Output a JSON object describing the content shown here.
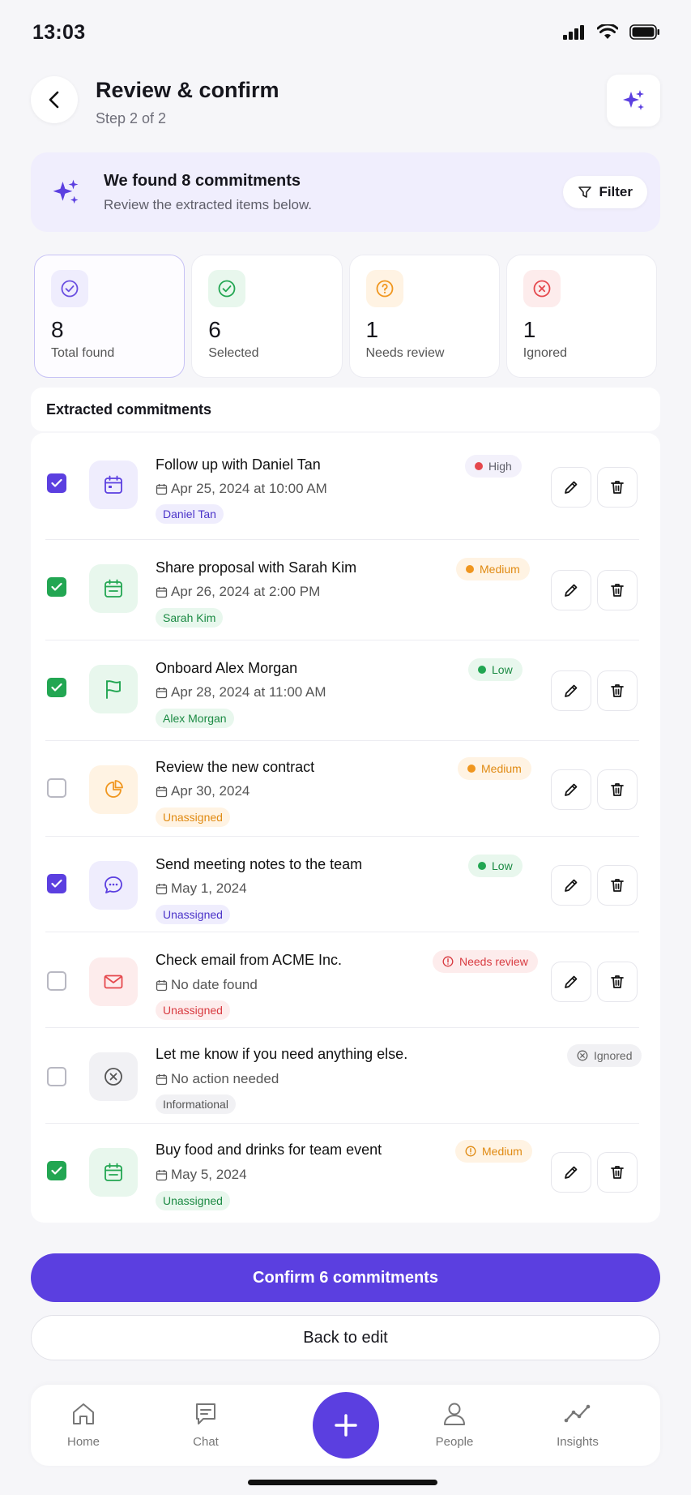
{
  "status_bar": {
    "time": "13:03"
  },
  "header": {
    "title": "Review & confirm",
    "subtitle": "Step 2 of 2"
  },
  "banner": {
    "title": "We found 8 commitments",
    "subtitle": "Review the extracted items below.",
    "filter_label": "Filter"
  },
  "stats": [
    {
      "value": "8",
      "label": "Total found",
      "icon": "check-circle-icon",
      "color": "#6a4fe0"
    },
    {
      "value": "6",
      "label": "Selected",
      "icon": "check-circle-icon",
      "color": "#22a652"
    },
    {
      "value": "1",
      "label": "Needs review",
      "icon": "question-circle-icon",
      "color": "#f0961e"
    },
    {
      "value": "1",
      "label": "Ignored",
      "icon": "x-circle-icon",
      "color": "#e5484d"
    }
  ],
  "section": {
    "title": "Extracted commitments"
  },
  "items": [
    {
      "title": "Follow up with Daniel Tan",
      "date": "Apr 25, 2024 at 10:00 AM",
      "tag": "Daniel Tan",
      "badge": "High",
      "checked": true,
      "icon": "calendar-icon"
    },
    {
      "title": "Share proposal with Sarah Kim",
      "date": "Apr 26, 2024 at 2:00 PM",
      "tag": "Sarah Kim",
      "badge": "Medium",
      "checked": true,
      "icon": "calendar-icon"
    },
    {
      "title": "Onboard Alex Morgan",
      "date": "Apr 28, 2024 at 11:00 AM",
      "tag": "Alex Morgan",
      "badge": "Low",
      "checked": true,
      "icon": "flag-icon"
    },
    {
      "title": "Review the new contract",
      "date": "Apr 30, 2024",
      "tag": "Unassigned",
      "badge": "Medium",
      "checked": false,
      "icon": "pie-chart-icon"
    },
    {
      "title": "Send meeting notes to the team",
      "date": "May 1, 2024",
      "tag": "Unassigned",
      "badge": "Low",
      "checked": true,
      "icon": "chat-icon"
    },
    {
      "title": "Check email from ACME Inc.",
      "date": "No date found",
      "tag": "Unassigned",
      "badge": "Needs review",
      "checked": false,
      "icon": "mail-icon"
    },
    {
      "title": "Let me know if you need anything else.",
      "date": "No action needed",
      "tag": "Informational",
      "badge": "Ignored",
      "checked": false,
      "icon": "x-circle-icon"
    },
    {
      "title": "Buy food and drinks for team event",
      "date": "May 5, 2024",
      "tag": "Unassigned",
      "badge": "Medium",
      "checked": true,
      "icon": "calendar-icon"
    }
  ],
  "actions": {
    "confirm_label": "Confirm 6 commitments",
    "back_label": "Back to edit"
  },
  "tabbar": {
    "home": "Home",
    "chat": "Chat",
    "people": "People",
    "insights": "Insights"
  },
  "colors": {
    "accent": "#5b3fe0",
    "green": "#22a652",
    "orange": "#f0961e",
    "red": "#e5484d"
  }
}
